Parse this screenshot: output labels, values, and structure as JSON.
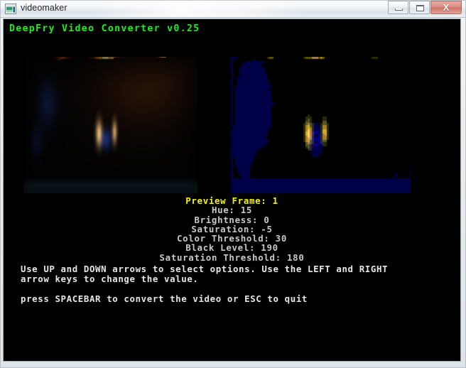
{
  "window": {
    "title": "videomaker",
    "icon": "media-window-icon",
    "controls": {
      "minimize_label": "─",
      "maximize_label": "□",
      "close_label": "X",
      "minimize_name": "minimize-button",
      "maximize_name": "maximize-button",
      "close_name": "close-button"
    }
  },
  "console": {
    "banner": "DeepFry Video Converter v0.25",
    "banner_color": "#1cf01c",
    "background_color": "#000000",
    "selected_color": "#f4f400",
    "text_color": "#c8c8c8"
  },
  "previews": {
    "original": {
      "label": "original-preview",
      "description": "fireplace with burning logs and orange flames"
    },
    "processed": {
      "label": "deepfried-preview",
      "description": "posterized color-quantized fireplace frame"
    }
  },
  "parameters": [
    {
      "label": "Preview Frame: 1",
      "selected": true
    },
    {
      "label": "Hue: 15",
      "selected": false
    },
    {
      "label": "Brightness: 0",
      "selected": false
    },
    {
      "label": "Saturation: -5",
      "selected": false
    },
    {
      "label": "Color Threshold: 30",
      "selected": false
    },
    {
      "label": "Black Level: 190",
      "selected": false
    },
    {
      "label": "Saturation Threshold: 180",
      "selected": false
    }
  ],
  "help": {
    "line1": "Use UP and DOWN arrows to select options. Use the LEFT and RIGHT",
    "line2": "arrow keys to change the value.",
    "line3": "press SPACEBAR to convert the video or ESC to quit"
  }
}
